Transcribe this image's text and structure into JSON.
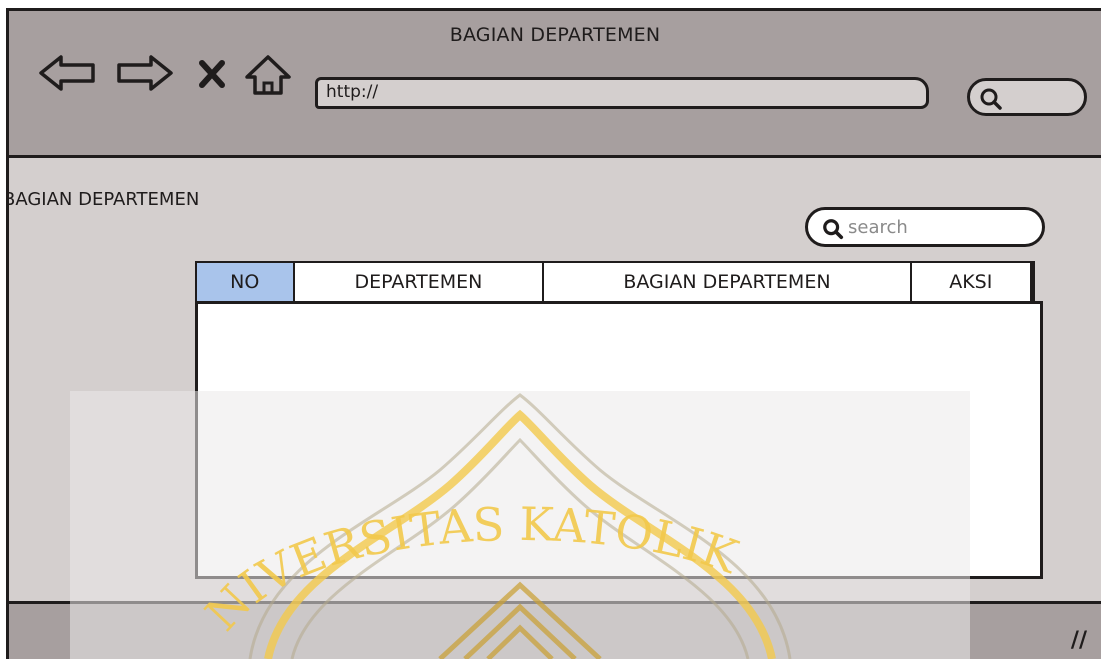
{
  "window": {
    "title": "BAGIAN DEPARTEMEN",
    "nav": [
      "back-arrow-icon",
      "forward-arrow-icon",
      "close-x-icon",
      "home-icon"
    ]
  },
  "addressbar": {
    "value": "http://"
  },
  "page": {
    "heading": "BAGIAN DEPARTEMEN",
    "search_placeholder": "search"
  },
  "table": {
    "columns": [
      "NO",
      "DEPARTEMEN",
      "BAGIAN DEPARTEMEN",
      "AKSI"
    ],
    "rows": []
  },
  "watermark": {
    "text": "NIVERSITAS KATOLIK",
    "color": "#f2c94c"
  }
}
